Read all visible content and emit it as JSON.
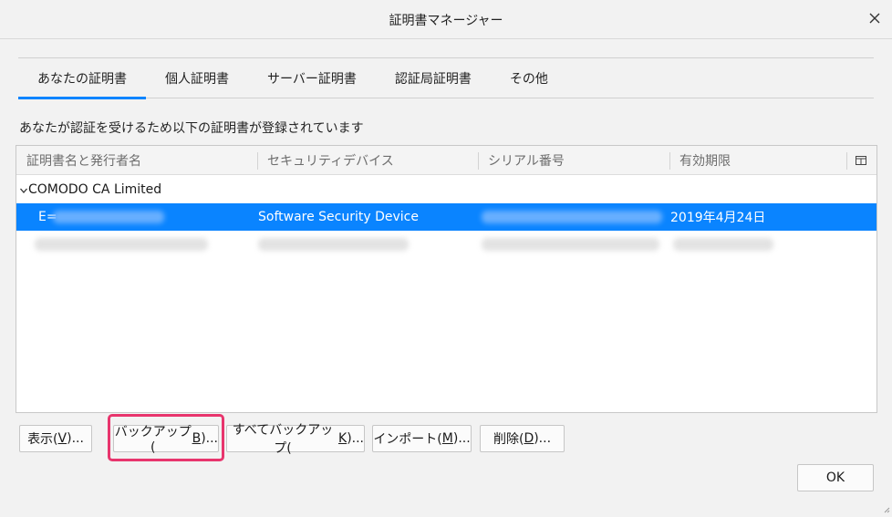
{
  "window": {
    "title": "証明書マネージャー"
  },
  "tabs": [
    {
      "label": "あなたの証明書",
      "active": true
    },
    {
      "label": "個人証明書",
      "active": false
    },
    {
      "label": "サーバー証明書",
      "active": false
    },
    {
      "label": "認証局証明書",
      "active": false
    },
    {
      "label": "その他",
      "active": false
    }
  ],
  "description": "あなたが認証を受けるため以下の証明書が登録されています",
  "table": {
    "columns": [
      "証明書名と発行者名",
      "セキュリティデバイス",
      "シリアル番号",
      "有効期限"
    ],
    "group": "COMODO CA Limited",
    "selected_row": {
      "name_prefix": "E=",
      "device": "Software Security Device",
      "expires": "2019年4月24日"
    }
  },
  "buttons": {
    "view": {
      "label": "表示(",
      "key": "V",
      "suffix": ")..."
    },
    "backup": {
      "label": "バックアップ(",
      "key": "B",
      "suffix": ")..."
    },
    "backup_all": {
      "label": "すべてバックアップ(",
      "key": "K",
      "suffix": ")..."
    },
    "import": {
      "label": "インポート(",
      "key": "M",
      "suffix": ")..."
    },
    "delete": {
      "label": "削除(",
      "key": "D",
      "suffix": ")..."
    },
    "ok": "OK"
  },
  "colors": {
    "accent": "#0a84ff",
    "highlight": "#e8356d"
  }
}
